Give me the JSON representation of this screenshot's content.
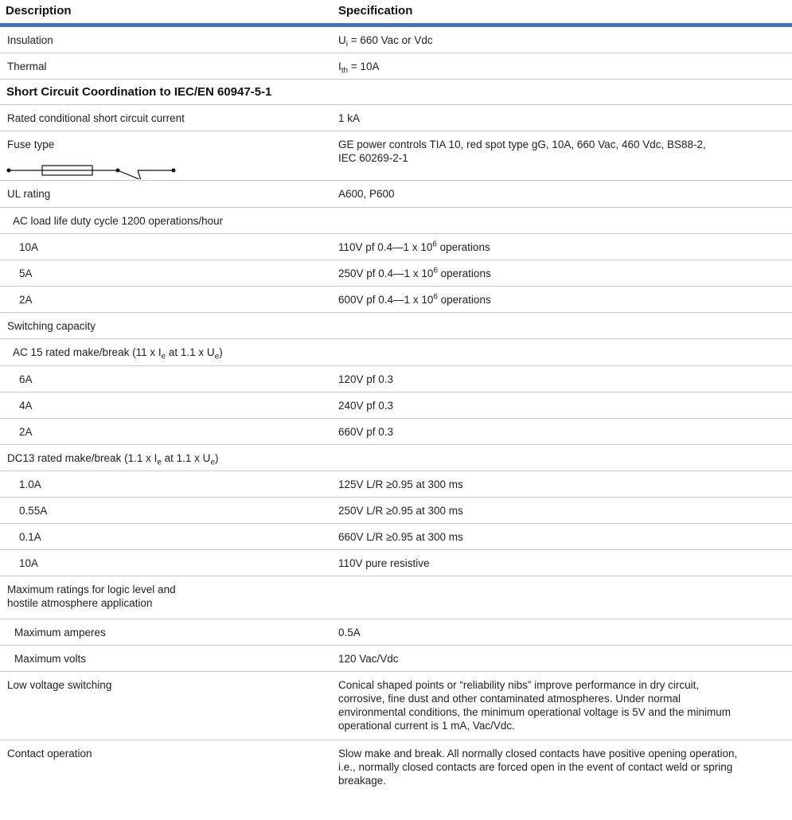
{
  "header": {
    "description": "Description",
    "specification": "Specification"
  },
  "rows": {
    "insulation": {
      "desc": "Insulation",
      "spec_pre": "U",
      "spec_sub": "i",
      "spec_post": " = 660 Vac or Vdc"
    },
    "thermal": {
      "desc": "Thermal",
      "spec_pre": "I",
      "spec_sub": "th",
      "spec_post": " = 10A"
    },
    "section_title": "Short Circuit Coordination to IEC/EN 60947-5-1",
    "rated_conditional": {
      "desc": "Rated conditional short circuit current",
      "spec": "1 kA"
    },
    "fuse_type": {
      "desc": "Fuse type",
      "spec_line1": "GE power controls TIA 10, red spot type gG, 10A, 660 Vac, 460 Vdc, BS88-2,",
      "spec_line2": "IEC 60269-2-1",
      "icon": "fuse-symbol-icon"
    },
    "ul_rating": {
      "desc": "UL rating",
      "spec": "A600, P600"
    },
    "ac_load_life": {
      "desc": "AC load life duty cycle 1200 operations/hour"
    },
    "ac_10a": {
      "desc": "10A",
      "spec_pre": "110V pf 0.4—1 x 10",
      "spec_sup": "6",
      "spec_post": " operations"
    },
    "ac_5a": {
      "desc": "5A",
      "spec_pre": "250V pf 0.4—1 x 10",
      "spec_sup": "6",
      "spec_post": " operations"
    },
    "ac_2a": {
      "desc": "2A",
      "spec_pre": "600V pf 0.4—1 x 10",
      "spec_sup": "6",
      "spec_post": " operations"
    },
    "switching_capacity": {
      "desc": "Switching capacity"
    },
    "ac15": {
      "desc_a": "AC 15 rated make/break (11 x I",
      "desc_sub1": "e",
      "desc_b": " at 1.1 x U",
      "desc_sub2": "e",
      "desc_c": ")"
    },
    "ac15_6a": {
      "desc": "6A",
      "spec": "120V pf 0.3"
    },
    "ac15_4a": {
      "desc": "4A",
      "spec": "240V pf 0.3"
    },
    "ac15_2a": {
      "desc": "2A",
      "spec": "660V pf 0.3"
    },
    "dc13": {
      "desc_a": "DC13 rated make/break (1.1 x I",
      "desc_sub1": "e",
      "desc_b": " at 1.1 x U",
      "desc_sub2": "e",
      "desc_c": ")"
    },
    "dc13_1a": {
      "desc": "1.0A",
      "spec": "125V L/R ≥0.95 at 300 ms"
    },
    "dc13_055a": {
      "desc": "0.55A",
      "spec": "250V L/R ≥0.95 at 300 ms"
    },
    "dc13_01a": {
      "desc": "0.1A",
      "spec": "660V L/R ≥0.95 at 300 ms"
    },
    "dc13_10a": {
      "desc": "10A",
      "spec": "110V pure resistive"
    },
    "max_ratings": {
      "desc_line1": "Maximum ratings for logic level and",
      "desc_line2": "hostile atmosphere application"
    },
    "max_amperes": {
      "desc": "Maximum amperes",
      "spec": "0.5A"
    },
    "max_volts": {
      "desc": "Maximum volts",
      "spec": "120 Vac/Vdc"
    },
    "low_voltage": {
      "desc": "Low voltage switching",
      "spec_lines": [
        "Conical shaped points or “reliability nibs” improve performance in dry circuit,",
        "corrosive, fine dust and other contaminated atmospheres. Under normal",
        "environmental conditions, the minimum operational voltage is 5V and the minimum",
        "operational current is 1 mA, Vac/Vdc."
      ]
    },
    "contact_operation": {
      "desc": "Contact operation",
      "spec_lines": [
        "Slow make and break. All normally closed contacts have positive opening operation,",
        "i.e., normally closed contacts are forced open in the event of contact weld or spring",
        "breakage."
      ]
    }
  }
}
